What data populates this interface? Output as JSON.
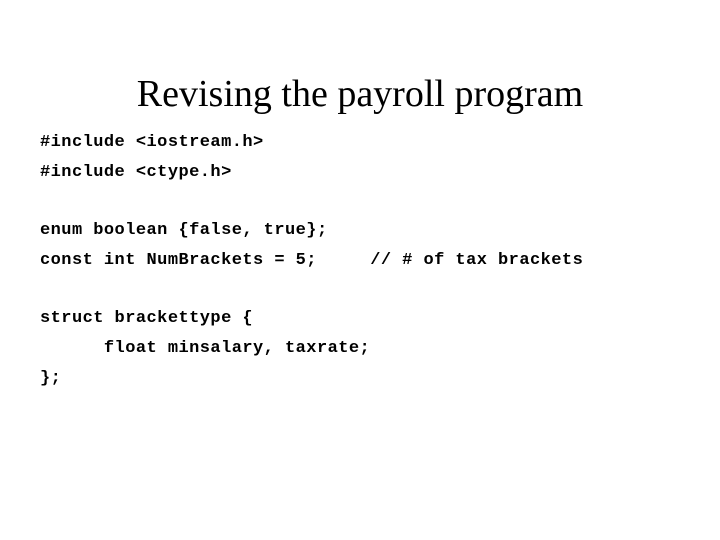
{
  "slide": {
    "title": "Revising the payroll program",
    "background_color": "#ffffff",
    "text_color": "#000000",
    "code_lines": [
      "#include <iostream.h>",
      "#include <ctype.h>",
      "",
      "enum boolean {false, true};",
      "const int NumBrackets = 5;     // # of tax brackets",
      "",
      "struct brackettype {",
      "      float minsalary, taxrate;",
      "};"
    ]
  }
}
